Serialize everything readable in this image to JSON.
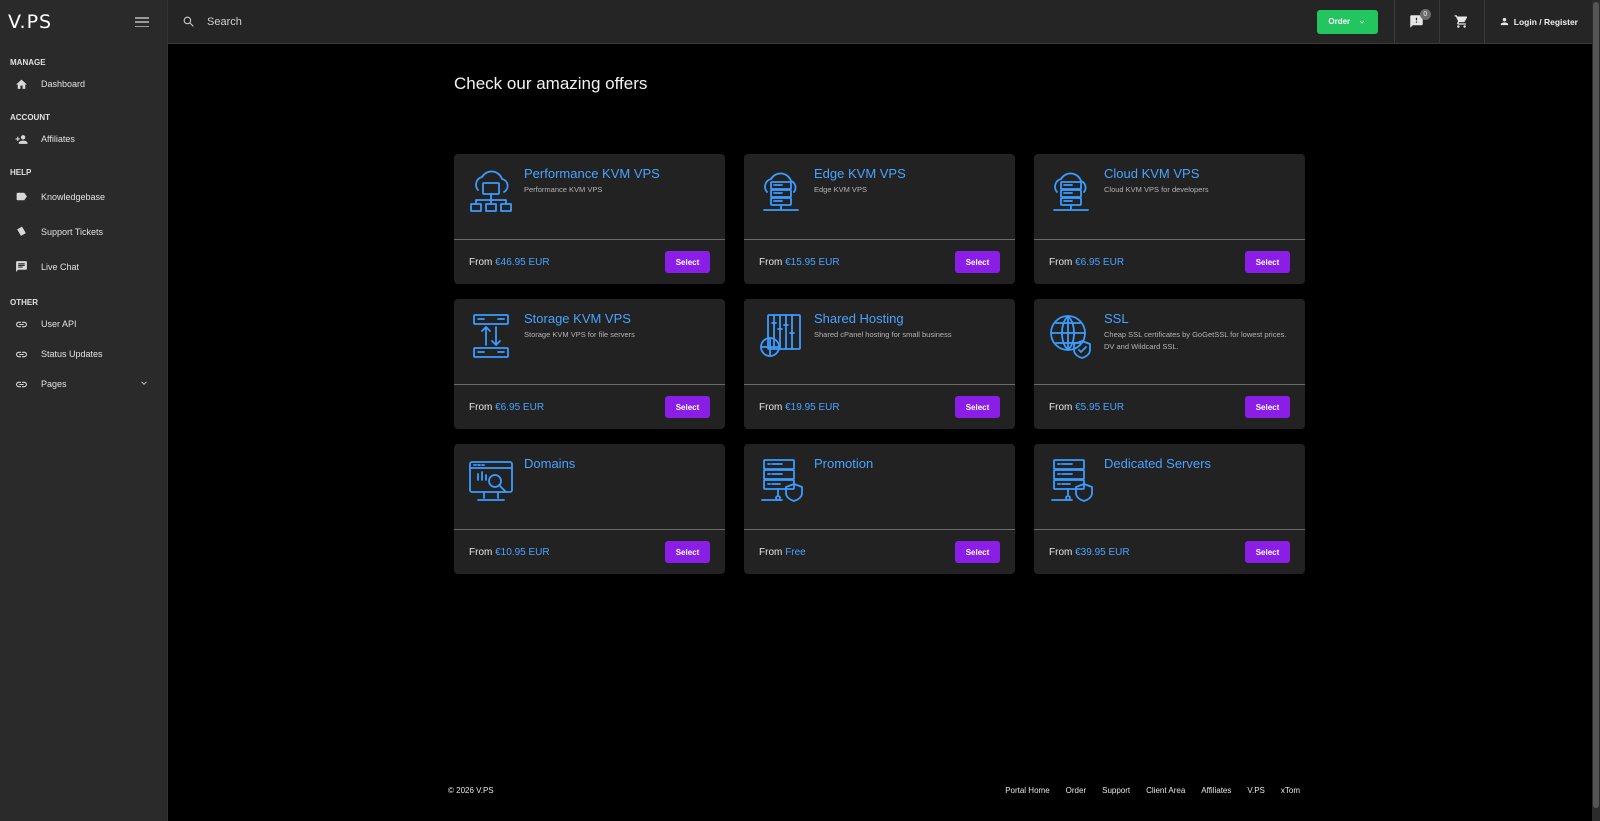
{
  "brand": "V.PS",
  "sidebar": {
    "sections": [
      {
        "heading": "MANAGE",
        "items": [
          {
            "label": "Dashboard",
            "icon": "home-icon"
          }
        ]
      },
      {
        "heading": "ACCOUNT",
        "items": [
          {
            "label": "Affiliates",
            "icon": "user-plus-icon"
          }
        ]
      },
      {
        "heading": "HELP",
        "items": [
          {
            "label": "Knowledgebase",
            "icon": "label-icon"
          },
          {
            "label": "Support Tickets",
            "icon": "ticket-icon"
          },
          {
            "label": "Live Chat",
            "icon": "chat-icon"
          }
        ]
      },
      {
        "heading": "OTHER",
        "items": [
          {
            "label": "User API",
            "icon": "link-icon"
          },
          {
            "label": "Status Updates",
            "icon": "link-icon"
          },
          {
            "label": "Pages",
            "icon": "link-icon"
          }
        ]
      }
    ]
  },
  "topbar": {
    "search_placeholder": "Search",
    "order_label": "Order",
    "notifications_count": "0",
    "login_label": "Login / Register"
  },
  "main": {
    "title": "Check our amazing offers",
    "price_prefix": "From",
    "select_label": "Select",
    "products": [
      {
        "title": "Performance KVM VPS",
        "desc": "Performance KVM VPS",
        "price": "€46.95 EUR",
        "icon": "cloud-network-icon"
      },
      {
        "title": "Edge KVM VPS",
        "desc": "Edge KVM VPS",
        "price": "€15.95 EUR",
        "icon": "cloud-server-icon"
      },
      {
        "title": "Cloud KVM VPS",
        "desc": "Cloud KVM VPS for developers",
        "price": "€6.95 EUR",
        "icon": "cloud-server-icon"
      },
      {
        "title": "Storage KVM VPS",
        "desc": "Storage KVM VPS for file servers",
        "price": "€6.95 EUR",
        "icon": "storage-transfer-icon"
      },
      {
        "title": "Shared Hosting",
        "desc": "Shared cPanel hosting for small business",
        "price": "€19.95 EUR",
        "icon": "shared-hosting-icon"
      },
      {
        "title": "SSL",
        "desc": "Cheap SSL certificates by GoGetSSL for lowest prices. DV and Wildcard SSL.",
        "price": "€5.95 EUR",
        "icon": "globe-shield-icon"
      },
      {
        "title": "Domains",
        "desc": "",
        "price": "€10.95 EUR",
        "icon": "domain-search-icon"
      },
      {
        "title": "Promotion",
        "desc": "",
        "price": "Free",
        "icon": "server-shield-icon"
      },
      {
        "title": "Dedicated Servers",
        "desc": "",
        "price": "€39.95 EUR",
        "icon": "server-shield-icon"
      }
    ]
  },
  "footer": {
    "copyright": "© 2026 V.PS",
    "links": [
      "Portal Home",
      "Order",
      "Support",
      "Client Area",
      "Affiliates",
      "V.PS",
      "xTom"
    ]
  },
  "colors": {
    "accent_blue": "#4aa3ff",
    "order_green": "#22c55e",
    "select_purple": "#8b1ee6",
    "sidebar_bg": "#2a2a2a",
    "card_bg": "#222222"
  }
}
